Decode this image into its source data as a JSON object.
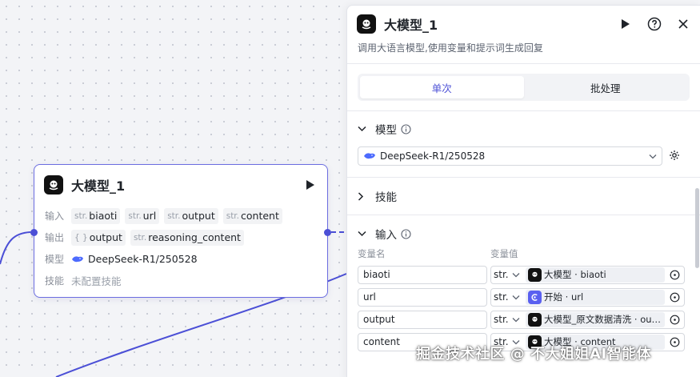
{
  "node": {
    "title": "大模型_1",
    "rows": {
      "input_label": "输入",
      "output_label": "输出",
      "model_label": "模型",
      "skill_label": "技能"
    },
    "inputs": [
      {
        "type": "str.",
        "name": "biaoti"
      },
      {
        "type": "str.",
        "name": "url"
      },
      {
        "type": "str.",
        "name": "output"
      },
      {
        "type": "str.",
        "name": "content"
      }
    ],
    "outputs": [
      {
        "type": "{ }",
        "name": "output"
      },
      {
        "type": "str.",
        "name": "reasoning_content"
      }
    ],
    "model": "DeepSeek-R1/250528",
    "skills": "未配置技能"
  },
  "panel": {
    "title": "大模型_1",
    "description": "调用大语言模型,使用变量和提示词生成回复",
    "tabs": [
      {
        "label": "单次",
        "active": true
      },
      {
        "label": "批处理",
        "active": false
      }
    ],
    "model_section": {
      "label": "模型",
      "selected": "DeepSeek-R1/250528"
    },
    "skill_section": {
      "label": "技能"
    },
    "input_section": {
      "label": "输入",
      "col_name": "变量名",
      "col_value": "变量值",
      "rows": [
        {
          "name": "biaoti",
          "type": "str.",
          "source": "大模型",
          "ref": "大模型 · biaoti"
        },
        {
          "name": "url",
          "type": "str.",
          "source": "开始",
          "ref": "开始 · url"
        },
        {
          "name": "output",
          "type": "str.",
          "source": "大模型",
          "ref": "大模型_原文数据清洗 · ou…"
        },
        {
          "name": "content",
          "type": "str.",
          "source": "大模型",
          "ref": "大模型 · content"
        }
      ]
    }
  },
  "watermark": "掘金技术社区 @ 不大姐姐AI智能体",
  "colors": {
    "accent": "#4b4fd6",
    "edge": "#4b4fd6",
    "node_border": "#6b6de0"
  }
}
